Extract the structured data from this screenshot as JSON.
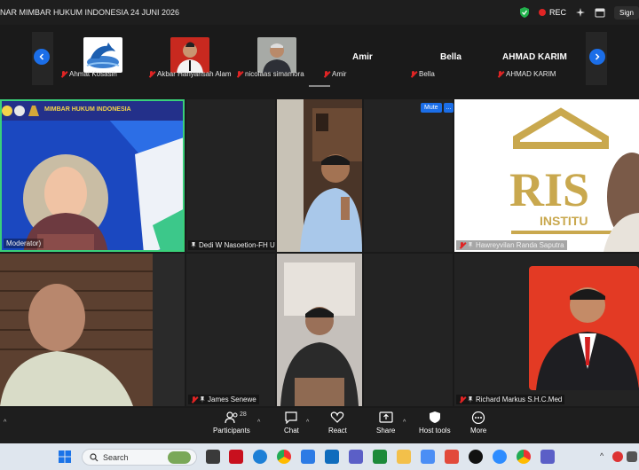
{
  "window": {
    "title": "NAR MIMBAR HUKUM INDONESIA 24 JUNI 2026",
    "rec_label": "REC",
    "sign_label": "Sign"
  },
  "filmstrip": {
    "thumbs": [
      {
        "name": "Ahmat Kosasih"
      },
      {
        "name": "Akbar Hariyansah Alam"
      },
      {
        "name": "nicolaas simamora"
      }
    ],
    "text_tiles": [
      {
        "display": "Amir",
        "name": "Amir"
      },
      {
        "display": "Bella",
        "name": "Bella"
      },
      {
        "display": "AHMAD KARIM",
        "name": "AHMAD KARIM"
      }
    ]
  },
  "grid": {
    "banner_text": "MIMBAR HUKUM INDONESIA",
    "moderator_tag": "Moderator)",
    "tiles": [
      {
        "name": "Dedi W Nasoetion-FH Unitomo"
      },
      {
        "name": "Hawreyvilan Randa Saputra"
      },
      {
        "name": "James Senewe"
      },
      {
        "name": "Richard Markus S.H.C.Med"
      }
    ],
    "mute_label": "Mute",
    "more_label": "...",
    "rise_logo": "RIS",
    "rise_sub": "INSTITU"
  },
  "controls": {
    "participants_label": "Participants",
    "participants_count": "28",
    "chat_label": "Chat",
    "react_label": "React",
    "share_label": "Share",
    "host_tools_label": "Host tools",
    "more_label": "More"
  },
  "taskbar": {
    "search_placeholder": "Search"
  }
}
